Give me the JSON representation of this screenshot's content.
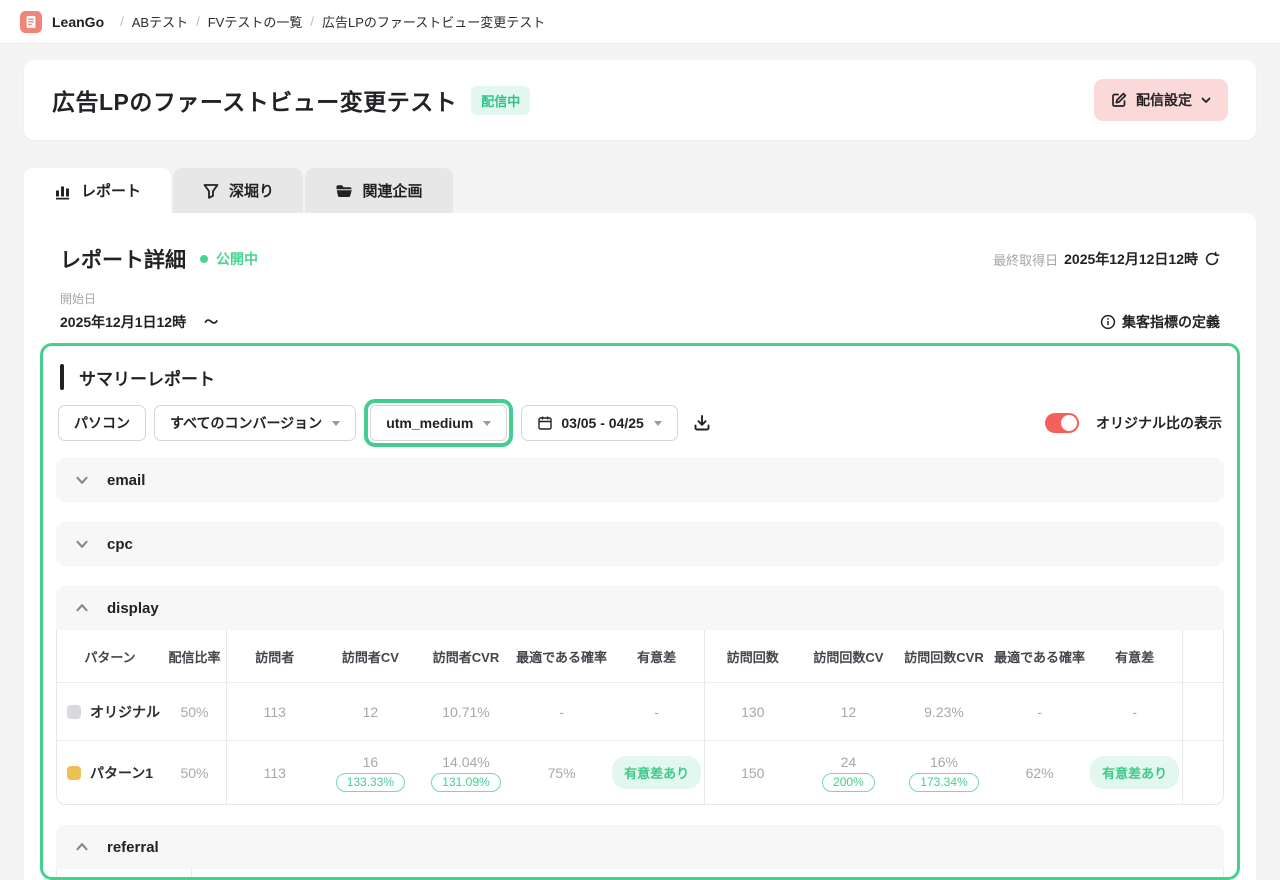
{
  "colors": {
    "accent_green": "#45D08F",
    "green_text": "#2EC488",
    "green_badge_bg": "#E2F8EE",
    "toggle_red": "#F4615B",
    "logo_salmon": "#EF8478",
    "settings_pink": "#FBD9D8",
    "swatch_original": "#D9D9DD",
    "swatch_pattern1": "#ECC152"
  },
  "topbar": {
    "brand": "LeanGo",
    "breadcrumb": [
      "ABテスト",
      "FVテストの一覧",
      "広告LPのファーストビュー変更テスト"
    ]
  },
  "header": {
    "title": "広告LPのファーストビュー変更テスト",
    "status": "配信中",
    "settings_label": "配信設定"
  },
  "tabs": {
    "report": "レポート",
    "drilldown": "深堀り",
    "related": "関連企画"
  },
  "report": {
    "title": "レポート詳細",
    "publish_status": "公開中",
    "last_fetched_label": "最終取得日",
    "last_fetched_value": "2025年12月12日12時",
    "start_label": "開始日",
    "start_value": "2025年12月1日12時",
    "tilde": "〜",
    "metrics_link": "集客指標の定義"
  },
  "summary": {
    "title": "サマリーレポート",
    "filters": {
      "device": "パソコン",
      "conversion": "すべてのコンバージョン",
      "medium": "utm_medium",
      "date_range": "03/05 - 04/25"
    },
    "toggle_label": "オリジナル比の表示",
    "sections": {
      "email": "email",
      "cpc": "cpc",
      "display": "display",
      "referral": "referral"
    }
  },
  "display_table": {
    "columns": [
      "パターン",
      "配信比率",
      "訪問者",
      "訪問者CV",
      "訪問者CVR",
      "最適である確率",
      "有意差",
      "訪問回数",
      "訪問回数CV",
      "訪問回数CVR",
      "最適である確率",
      "有意差"
    ],
    "original": {
      "label": "オリジナル",
      "ratio": "50%",
      "visitors": "113",
      "visitor_cv": "12",
      "visitor_cvr": "10.71%",
      "visitor_prob": "-",
      "visitor_sig": "-",
      "visits": "130",
      "visit_cv": "12",
      "visit_cvr": "9.23%",
      "visit_prob": "-",
      "visit_sig": "-"
    },
    "pattern1": {
      "label": "パターン1",
      "ratio": "50%",
      "visitors": "113",
      "visitor_cv": "16",
      "visitor_cv_ratio": "133.33%",
      "visitor_cvr": "14.04%",
      "visitor_cvr_ratio": "131.09%",
      "visitor_prob": "75%",
      "visitor_sig": "有意差あり",
      "visits": "150",
      "visit_cv": "24",
      "visit_cv_ratio": "200%",
      "visit_cvr": "16%",
      "visit_cvr_ratio": "173.34%",
      "visit_prob": "62%",
      "visit_sig": "有意差あり"
    }
  }
}
